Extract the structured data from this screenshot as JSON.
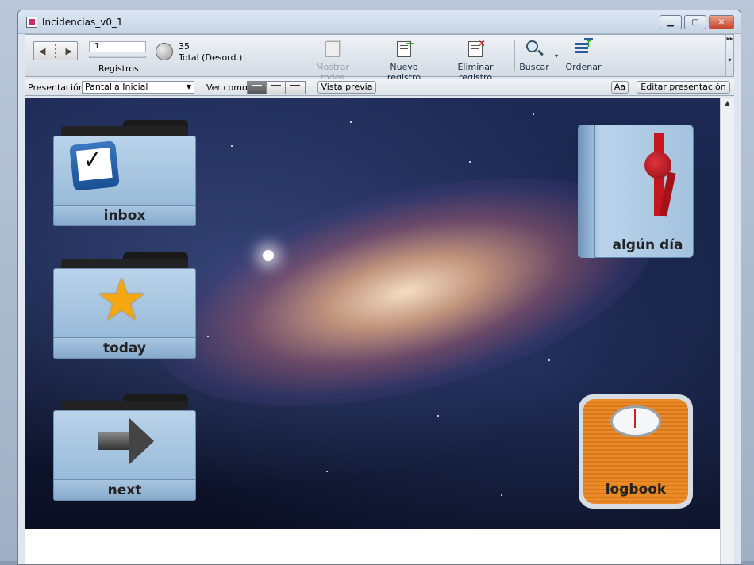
{
  "window": {
    "title": "Incidencias_v0_1"
  },
  "toolbar": {
    "record_value": "1",
    "records_label": "Registros",
    "total_count": "35",
    "total_status": "Total (Desord.)",
    "show_all": "Mostrar todos",
    "new_record": "Nuevo registro",
    "delete_record": "Eliminar registro",
    "find": "Buscar",
    "sort": "Ordenar"
  },
  "layoutbar": {
    "layout_label": "Presentación:",
    "layout_value": "Pantalla Inicial",
    "view_as_label": "Ver como:",
    "preview": "Vista previa",
    "text_size": "Aa",
    "edit_layout": "Editar presentación"
  },
  "home": {
    "inbox": "inbox",
    "today": "today",
    "next": "next",
    "someday": "algún día",
    "logbook": "logbook"
  }
}
